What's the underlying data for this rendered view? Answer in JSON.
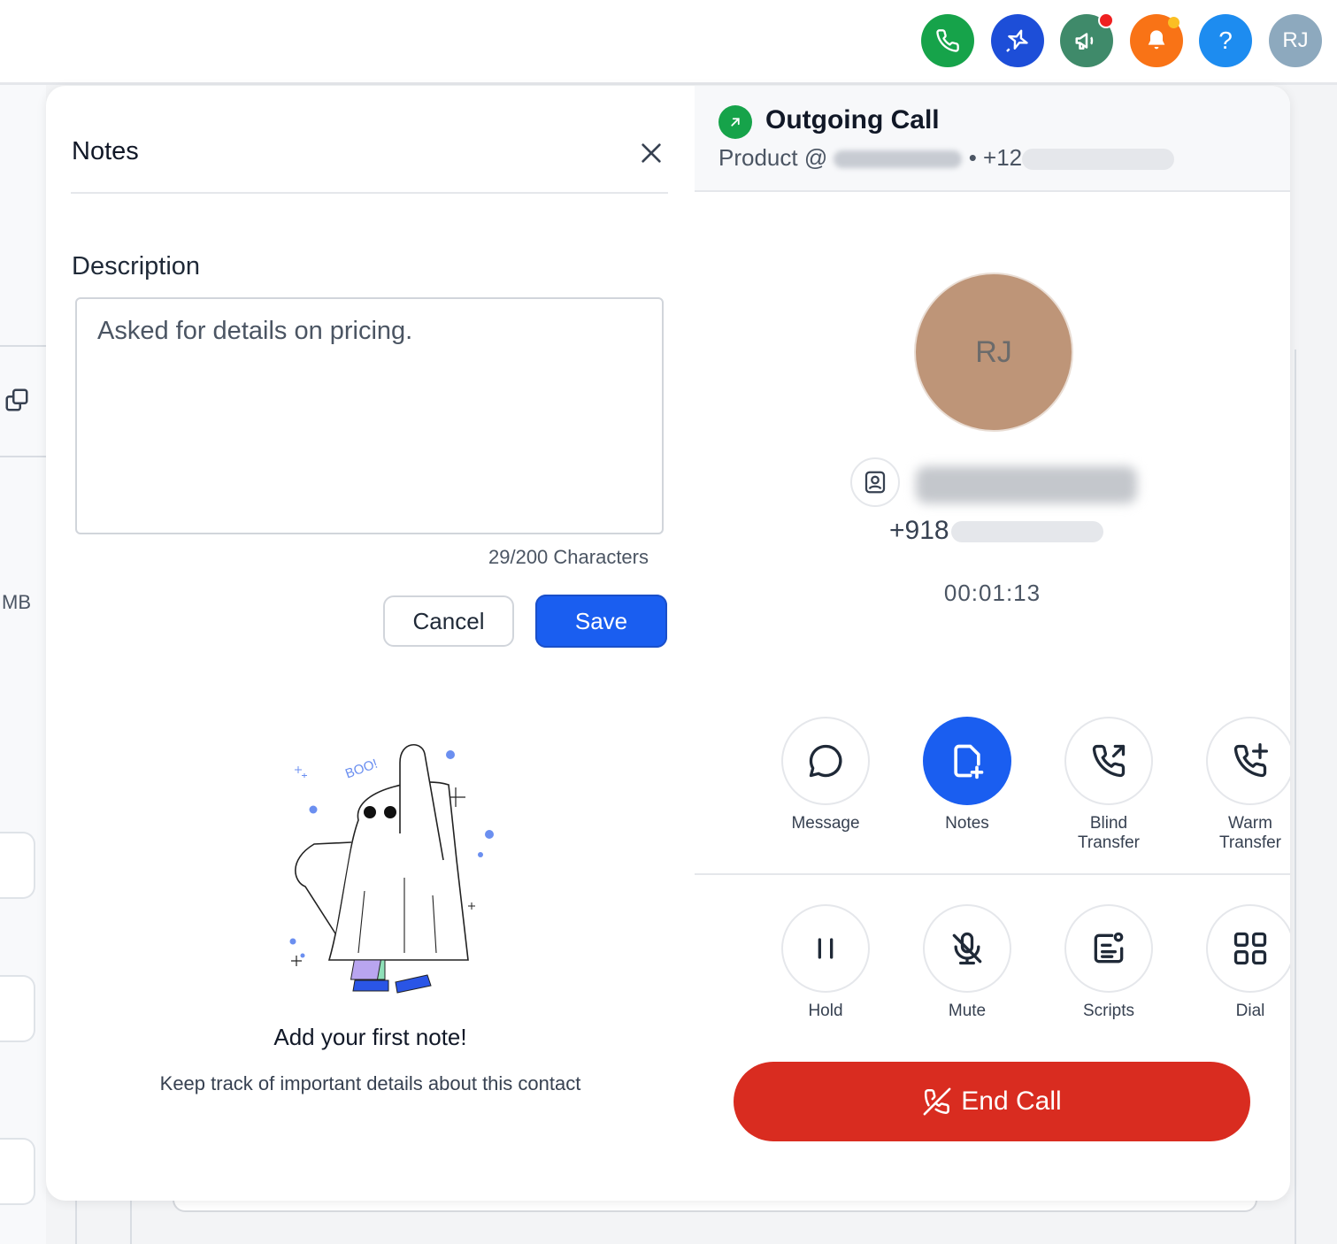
{
  "topbar": {
    "avatar_initials": "RJ",
    "help_glyph": "?",
    "icons": [
      {
        "name": "phone-icon",
        "color": "#16a34a"
      },
      {
        "name": "sparkle-icon",
        "color": "#1d4ed8"
      },
      {
        "name": "megaphone-icon",
        "color": "#3f8a6a"
      },
      {
        "name": "bell-icon",
        "color": "#f97316"
      },
      {
        "name": "help-icon",
        "color": "#1d8cf0"
      }
    ]
  },
  "background": {
    "size_label": "MB"
  },
  "notes": {
    "title": "Notes",
    "description_label": "Description",
    "description_value": "Asked for details on pricing.",
    "char_count": "29/200 Characters",
    "cancel_label": "Cancel",
    "save_label": "Save",
    "illustration_text": "BOO!",
    "empty_title": "Add your first note!",
    "empty_subtitle": "Keep track of important details about this contact"
  },
  "call": {
    "title": "Outgoing Call",
    "subtitle_prefix": "Product @",
    "subtitle_number": "• +12",
    "avatar_initials": "RJ",
    "phone_prefix": "+918",
    "timer": "00:01:13",
    "actions_row1": [
      {
        "label": "Message",
        "icon": "message-icon"
      },
      {
        "label": "Notes",
        "icon": "notes-icon",
        "active": true
      },
      {
        "label": "Blind\nTransfer",
        "icon": "blind-transfer-icon"
      },
      {
        "label": "Warm\nTransfer",
        "icon": "warm-transfer-icon"
      }
    ],
    "actions_row2": [
      {
        "label": "Hold",
        "icon": "pause-icon"
      },
      {
        "label": "Mute",
        "icon": "mic-off-icon"
      },
      {
        "label": "Scripts",
        "icon": "scripts-icon"
      },
      {
        "label": "Dial",
        "icon": "dialpad-icon"
      }
    ],
    "end_call_label": "End Call"
  },
  "colors": {
    "primary": "#1a5ef0",
    "danger": "#d92c20",
    "success": "#16a34a"
  }
}
